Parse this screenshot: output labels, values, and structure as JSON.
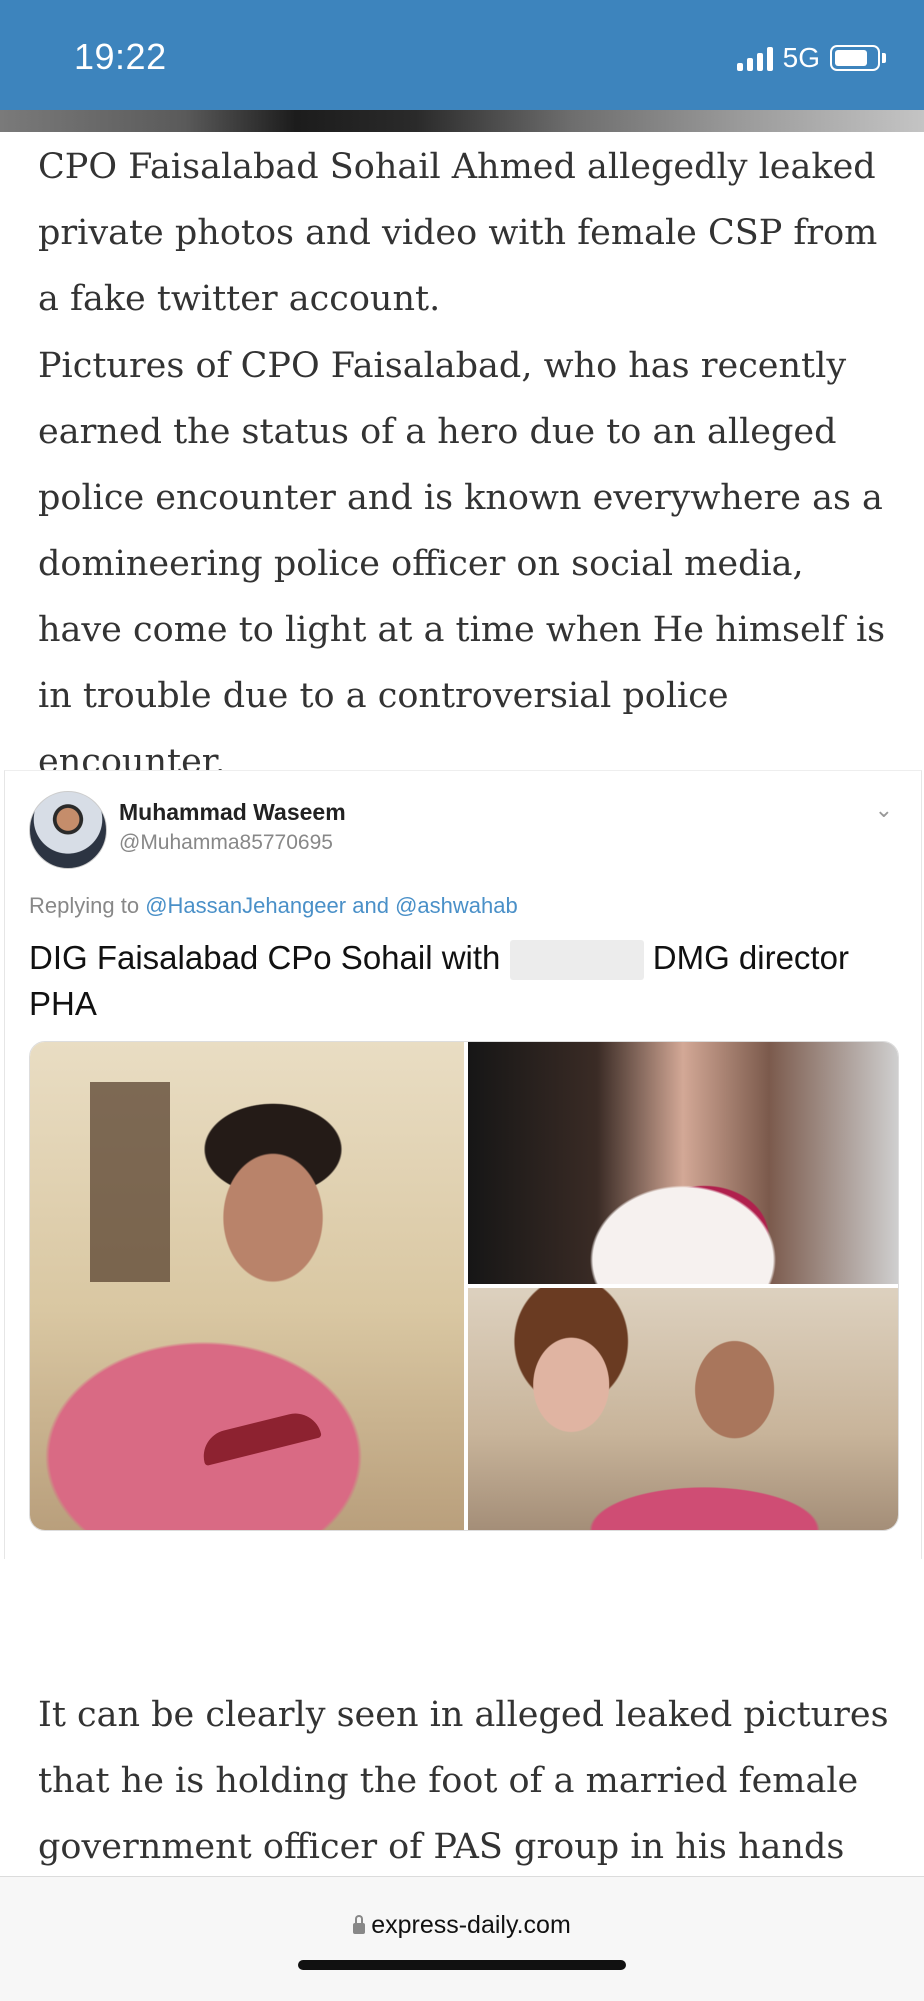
{
  "status_bar": {
    "time": "19:22",
    "network": "5G"
  },
  "article": {
    "paragraph_1": "CPO Faisalabad Sohail Ahmed allegedly leaked private photos and video with female CSP from a fake twitter account.",
    "paragraph_2": "Pictures of CPO Faisalabad, who has recently earned the status of a hero due to an alleged police encounter and is known everywhere as a domineering police officer on social media, have come to light at a time when He himself is in trouble due to a controversial police encounter.",
    "paragraph_3": "It can be clearly seen in alleged leaked pictures that he is holding the foot of a married female government officer of PAS group in his hands and"
  },
  "tweet": {
    "author_name": "Muhammad Waseem",
    "author_handle": "@Muhamma85770695",
    "reply_prefix": "Replying to",
    "reply_mention_1": "@HassanJehangeer",
    "reply_and": "and",
    "reply_mention_2": "@ashwahab",
    "text_before": "DIG Faisalabad CPo Sohail with",
    "text_after": "DMG director PHA"
  },
  "browser": {
    "url": "express-daily.com"
  },
  "icons": {
    "lock": "lock-icon",
    "chevron": "chevron-down-icon",
    "signal": "signal-icon",
    "battery": "battery-icon"
  },
  "colors": {
    "status_bar": "#3d84bd",
    "mention": "#4a90c8"
  }
}
